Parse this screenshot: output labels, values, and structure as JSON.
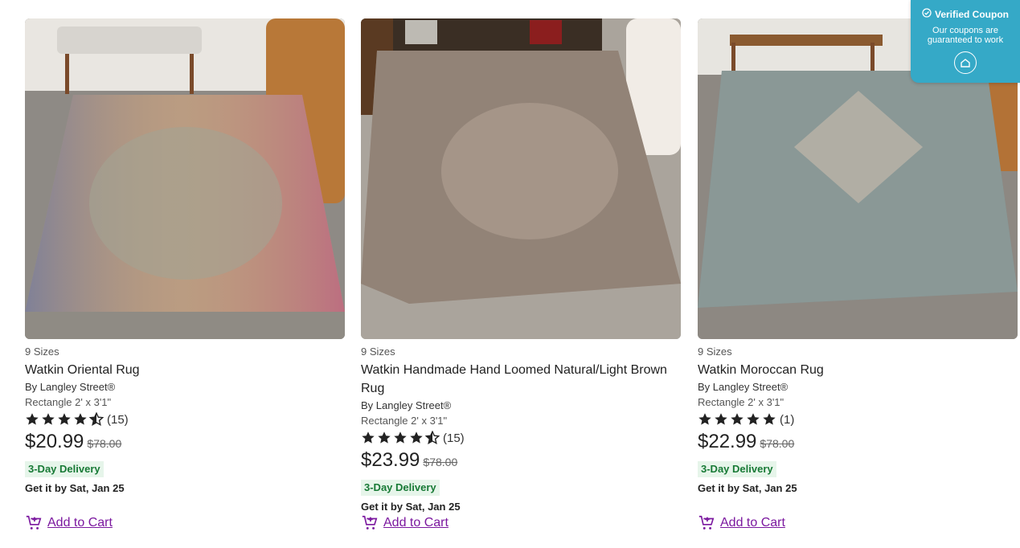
{
  "products": [
    {
      "sizes": "9 Sizes",
      "name": "Watkin Oriental Rug",
      "brand": "By Langley Street®",
      "dims": "Rectangle 2' x 3'1\"",
      "rating": 4.5,
      "rating_count": "(15)",
      "price": "$20.99",
      "was_price": "$78.00",
      "delivery_badge": "3-Day Delivery",
      "get_it": "Get it by Sat, Jan 25",
      "cart_label": "Add to Cart"
    },
    {
      "sizes": "9 Sizes",
      "name": "Watkin Handmade Hand Loomed Natural/Light Brown Rug",
      "brand": "By Langley Street®",
      "dims": "Rectangle 2' x 3'1\"",
      "rating": 4.5,
      "rating_count": "(15)",
      "price": "$23.99",
      "was_price": "$78.00",
      "delivery_badge": "3-Day Delivery",
      "get_it": "Get it by Sat, Jan 25",
      "cart_label": "Add to Cart"
    },
    {
      "sizes": "9 Sizes",
      "name": "Watkin Moroccan Rug",
      "brand": "By Langley Street®",
      "dims": "Rectangle 2' x 3'1\"",
      "rating": 5,
      "rating_count": "(1)",
      "price": "$22.99",
      "was_price": "$78.00",
      "delivery_badge": "3-Day Delivery",
      "get_it": "Get it by Sat, Jan 25",
      "cart_label": "Add to Cart"
    }
  ],
  "coupon": {
    "title": "Verified Coupon",
    "line1": "Our coupons are",
    "line2": "guaranteed to work",
    "icon": "home-icon"
  },
  "colors": {
    "cart_link": "#7b189f",
    "badge_bg": "#e6f5ea",
    "badge_text": "#187a36",
    "coupon_bg": "#35a9c7"
  }
}
